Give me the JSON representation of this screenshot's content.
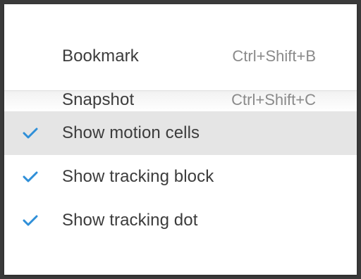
{
  "menu": {
    "top_items": [
      {
        "label": "Bookmark",
        "shortcut": "Ctrl+Shift+B"
      },
      {
        "label": "Snapshot",
        "shortcut": "Ctrl+Shift+C"
      }
    ],
    "toggle_items": [
      {
        "label": "Show motion cells",
        "checked": true,
        "highlighted": true
      },
      {
        "label": "Show tracking block",
        "checked": true,
        "highlighted": false
      },
      {
        "label": "Show tracking dot",
        "checked": true,
        "highlighted": false
      }
    ]
  },
  "colors": {
    "check_mark": "#2f8fd8",
    "highlight_bg": "#e5e5e5",
    "label_text": "#3c3c3c",
    "shortcut_text": "#8a8a8a"
  },
  "icons": {
    "check": "check-icon"
  }
}
